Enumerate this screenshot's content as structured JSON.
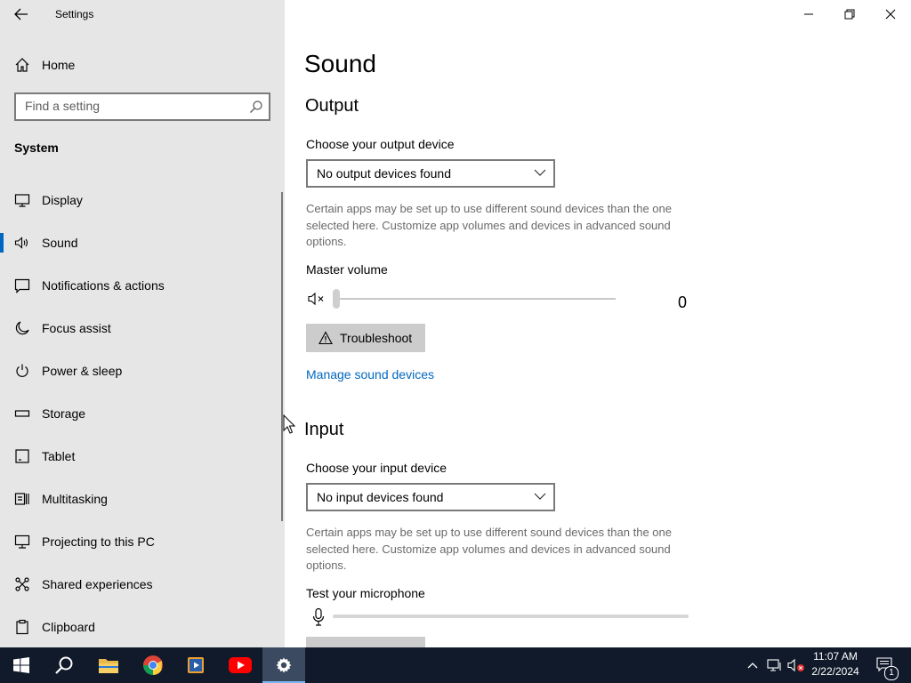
{
  "window": {
    "title": "Settings",
    "controls": {
      "minimize": "minimize-icon",
      "maximize": "restore-icon",
      "close": "close-icon"
    }
  },
  "sidebar": {
    "home_label": "Home",
    "search_placeholder": "Find a setting",
    "section_title": "System",
    "items": [
      {
        "label": "Display",
        "icon": "display-icon"
      },
      {
        "label": "Sound",
        "icon": "speaker-icon",
        "active": true
      },
      {
        "label": "Notifications & actions",
        "icon": "notifications-icon"
      },
      {
        "label": "Focus assist",
        "icon": "moon-icon"
      },
      {
        "label": "Power & sleep",
        "icon": "power-icon"
      },
      {
        "label": "Storage",
        "icon": "storage-icon"
      },
      {
        "label": "Tablet",
        "icon": "tablet-icon"
      },
      {
        "label": "Multitasking",
        "icon": "multitasking-icon"
      },
      {
        "label": "Projecting to this PC",
        "icon": "projecting-icon"
      },
      {
        "label": "Shared experiences",
        "icon": "shared-icon"
      },
      {
        "label": "Clipboard",
        "icon": "clipboard-icon"
      }
    ]
  },
  "main": {
    "title": "Sound",
    "output": {
      "heading": "Output",
      "device_label": "Choose your output device",
      "device_value": "No output devices found",
      "description": "Certain apps may be set up to use different sound devices than the one selected here. Customize app volumes and devices in advanced sound options.",
      "volume_label": "Master volume",
      "volume_value": "0",
      "volume_level": 0,
      "troubleshoot_label": "Troubleshoot",
      "manage_link": "Manage sound devices"
    },
    "input": {
      "heading": "Input",
      "device_label": "Choose your input device",
      "device_value": "No input devices found",
      "description": "Certain apps may be set up to use different sound devices than the one selected here. Customize app volumes and devices in advanced sound options.",
      "mic_label": "Test your microphone",
      "mic_level": 0
    }
  },
  "taskbar": {
    "apps": [
      "windows-start-icon",
      "search-icon",
      "file-explorer-icon",
      "chrome-icon",
      "media-player-icon",
      "youtube-icon",
      "settings-icon"
    ],
    "active_app": "settings-icon",
    "time": "11:07 AM",
    "date": "2/22/2024",
    "notification_count": "1"
  },
  "colors": {
    "accent": "#0067c0",
    "sidebar_bg": "#e6e6e6",
    "taskbar_bg": "#101a2a"
  }
}
